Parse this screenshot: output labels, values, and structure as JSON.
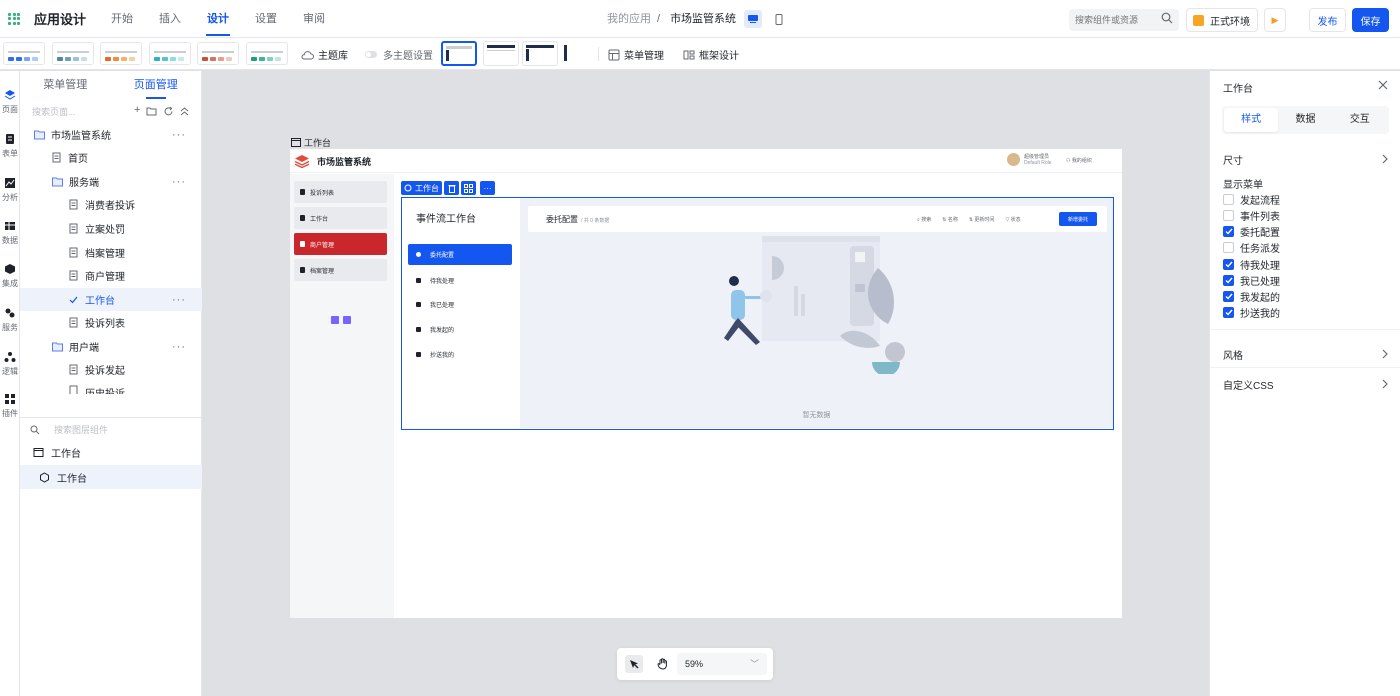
{
  "topbar": {
    "app_title": "应用设计",
    "nav": [
      "开始",
      "插入",
      "设计",
      "设置",
      "审阅"
    ],
    "active_nav": "设计",
    "breadcrumb_root": "我的应用",
    "breadcrumb_sep": "/",
    "breadcrumb_current": "市场监管系统",
    "search_placeholder": "搜索组件或资源",
    "env_label": "正式环境",
    "play_symbol": "▶",
    "publish_label": "发布",
    "save_label": "保存"
  },
  "toolbar": {
    "theme_lib": "主题库",
    "multi_theme": "多主题设置",
    "menu_manage": "菜单管理",
    "frame_design": "框架设计"
  },
  "rail": [
    "页面",
    "表单",
    "分析",
    "数据",
    "集成",
    "服务",
    "逻辑",
    "插件"
  ],
  "panel": {
    "tabs": [
      "菜单管理",
      "页面管理"
    ],
    "active_tab": "页面管理",
    "search_placeholder": "搜索页面...",
    "tree": [
      {
        "label": "市场监管系统",
        "type": "folder",
        "more": "···"
      },
      {
        "label": "首页",
        "type": "page"
      },
      {
        "label": "服务端",
        "type": "folder",
        "more": "···"
      },
      {
        "label": "消费者投诉",
        "type": "page"
      },
      {
        "label": "立案处罚",
        "type": "page"
      },
      {
        "label": "档案管理",
        "type": "page"
      },
      {
        "label": "商户管理",
        "type": "page"
      },
      {
        "label": "工作台",
        "type": "selected",
        "more": "···"
      },
      {
        "label": "投诉列表",
        "type": "page"
      },
      {
        "label": "用户端",
        "type": "folder",
        "more": "···"
      },
      {
        "label": "投诉发起",
        "type": "page"
      },
      {
        "label": "历史投诉",
        "type": "page"
      }
    ],
    "layer_search_placeholder": "搜索图层组件",
    "layers": [
      "工作台",
      "工作台"
    ]
  },
  "canvas": {
    "label": "工作台",
    "app_name": "市场监管系统",
    "user_name": "超级管理员",
    "user_role": "Default Role",
    "org": "我的组织",
    "sidebar": [
      "投诉列表",
      "工作台",
      "商户管理",
      "档案管理"
    ],
    "active_sidebar": "商户管理",
    "component_label": "工作台",
    "workflow_title": "事件流工作台",
    "workflow_items": [
      "委托配置",
      "待我处理",
      "我已处理",
      "我发起的",
      "抄送我的"
    ],
    "workflow_active": "委托配置",
    "header_title": "委托配置",
    "header_sub": "/ 共 0 条数据",
    "filters": [
      "搜索",
      "名称",
      "更新时间",
      "状态"
    ],
    "new_button": "新增委托",
    "empty_text": "暂无数据"
  },
  "controls": {
    "zoom": "59%",
    "caret": "﹀"
  },
  "inspector": {
    "title": "工作台",
    "tabs": [
      "样式",
      "数据",
      "交互"
    ],
    "active_tab": "样式",
    "size_label": "尺寸",
    "menu_label": "显示菜单",
    "menu_items": [
      {
        "label": "发起流程",
        "checked": false
      },
      {
        "label": "事件列表",
        "checked": false
      },
      {
        "label": "委托配置",
        "checked": true
      },
      {
        "label": "任务派发",
        "checked": false
      },
      {
        "label": "待我处理",
        "checked": true
      },
      {
        "label": "我已处理",
        "checked": true
      },
      {
        "label": "我发起的",
        "checked": true
      },
      {
        "label": "抄送我的",
        "checked": true
      }
    ],
    "style_label": "风格",
    "css_label": "自定义CSS"
  },
  "colors": {
    "accent": "#1456f0",
    "brand_red": "#c9272b"
  }
}
